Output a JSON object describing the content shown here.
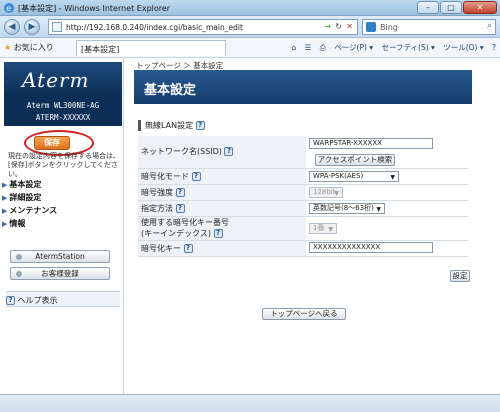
{
  "window": {
    "title": "[基本設定] - Windows Internet Explorer",
    "minimize": "–",
    "maximize": "□",
    "close": "✕"
  },
  "browser": {
    "url": "http://192.168.0.240/index.cgi/basic_main_edit",
    "search_engine": "Bing",
    "favorites_label": "お気に入り",
    "tab_label": "[基本設定]",
    "commands": [
      "ページ(P) ▾",
      "セーフティ(S) ▾",
      "ツール(O) ▾",
      "?"
    ]
  },
  "sidebar": {
    "logo": "Aterm",
    "model_line1": "Aterm WL300NE-AG",
    "model_line2": "ATERM-XXXXXX",
    "save_label": "保存",
    "save_note": "現在の設定内容を保存する場合は、[保存]ボタンをクリックしてください。",
    "menu": [
      "基本設定",
      "詳細設定",
      "メンテナンス",
      "情報"
    ],
    "station_button": "AtermStation",
    "register_button": "お客様登録",
    "help_label": "ヘルプ表示"
  },
  "main": {
    "breadcrumb": "トップページ ＞ 基本設定",
    "page_title": "基本設定",
    "section_title": "無線LAN設定",
    "fields": {
      "ssid_label": "ネットワーク名(SSID)",
      "ssid_value": "WARPSTAR-XXXXXX",
      "scan_button": "アクセスポイント検索",
      "encryption_label": "暗号化モード",
      "encryption_value": "WPA-PSK(AES)",
      "strength_label": "暗号強度",
      "strength_value": "128bit",
      "method_label": "指定方法",
      "method_value": "英数記号(8〜63桁)",
      "keyindex_label_1": "使用する暗号化キー番号",
      "keyindex_label_2": "(キーインデックス)",
      "keyindex_value": "1番",
      "key_label": "暗号化キー",
      "key_value": "XXXXXXXXXXXXXX"
    },
    "set_button": "設定",
    "top_button": "トップページへ戻る"
  },
  "icons": {
    "help": "?",
    "menu_arrow": "▶",
    "back": "◀",
    "forward": "▶"
  }
}
